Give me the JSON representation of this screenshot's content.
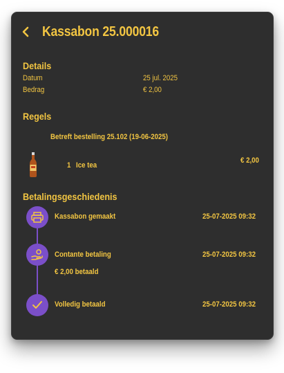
{
  "header": {
    "title": "Kassabon 25.000016"
  },
  "details": {
    "heading": "Details",
    "rows": [
      {
        "label": "Datum",
        "value": "25 jul. 2025"
      },
      {
        "label": "Bedrag",
        "value": "€ 2,00"
      }
    ]
  },
  "regels": {
    "heading": "Regels",
    "reference": "Betreft bestelling 25.102 (19-06-2025)",
    "items": [
      {
        "qty": "1",
        "name": "Ice tea",
        "price": "€ 2,00",
        "icon": "bottle-icon"
      }
    ]
  },
  "history": {
    "heading": "Betalingsgeschiedenis",
    "events": [
      {
        "label": "Kassabon gemaakt",
        "time": "25-07-2025 09:32",
        "icon": "printer-icon"
      },
      {
        "label": "Contante betaling",
        "time": "25-07-2025 09:32",
        "sub": "€ 2,00 betaald",
        "icon": "cash-hand-icon"
      },
      {
        "label": "Volledig betaald",
        "time": "25-07-2025 09:32",
        "icon": "check-icon"
      }
    ]
  },
  "colors": {
    "accent": "#f2c542",
    "card": "#2e2e2e",
    "timeline": "#7b4fc9"
  }
}
